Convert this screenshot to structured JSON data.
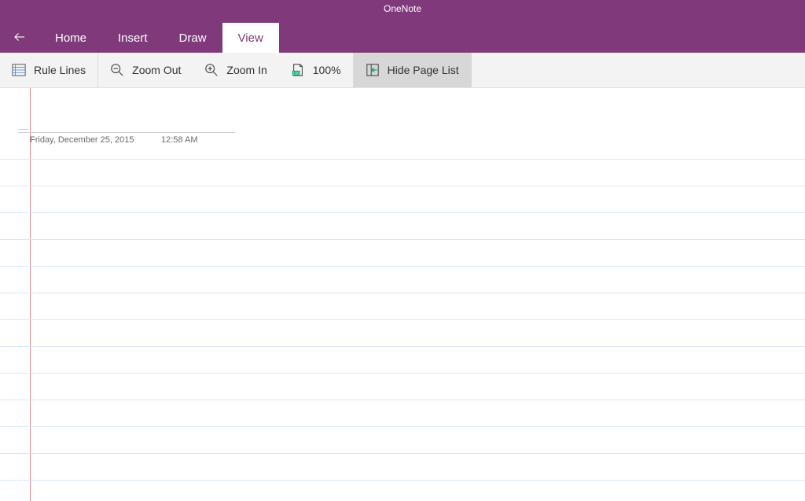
{
  "app_title": "OneNote",
  "tabs": {
    "home": "Home",
    "insert": "Insert",
    "draw": "Draw",
    "view": "View",
    "active": "view"
  },
  "ribbon": {
    "rule_lines": "Rule Lines",
    "zoom_out": "Zoom Out",
    "zoom_in": "Zoom In",
    "zoom_100": "100%",
    "hide_page_list": "Hide Page List"
  },
  "page": {
    "date": "Friday, December 25, 2015",
    "time": "12:58 AM"
  },
  "colors": {
    "brand": "#80397B",
    "rule_line": "#d9e8f5",
    "margin": "#e08a8a"
  }
}
